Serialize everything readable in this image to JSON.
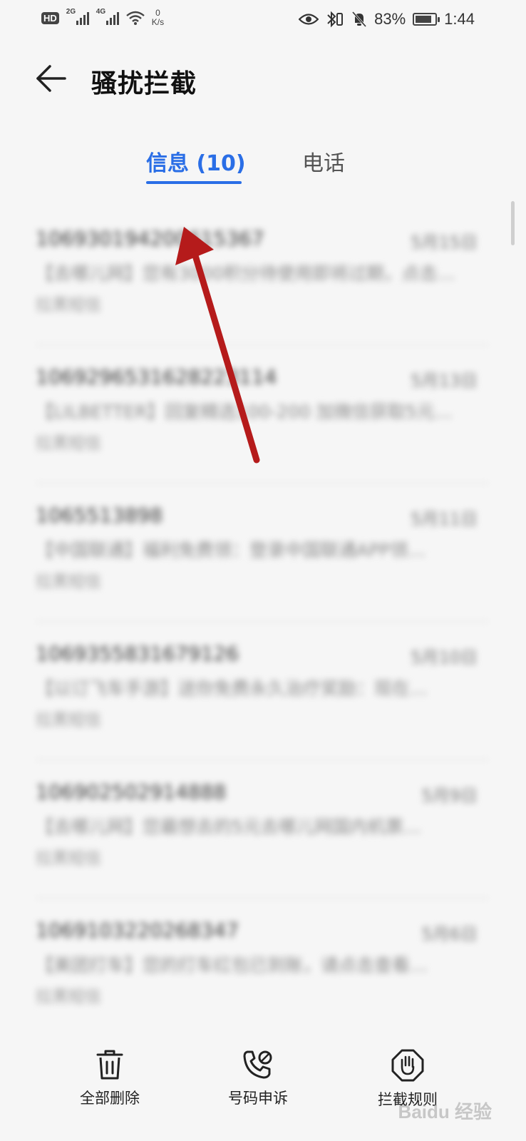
{
  "status_bar": {
    "hd_badge": "HD",
    "sim1_network": "2G",
    "sim2_network": "4G",
    "net_speed_value": "0",
    "net_speed_unit": "K/s",
    "battery_percent": "83%",
    "battery_level": 0.83,
    "time": "1:44"
  },
  "header": {
    "back_icon": "back-arrow-icon",
    "title": "骚扰拦截"
  },
  "tabs": [
    {
      "label": "信息 (10)",
      "selected": true
    },
    {
      "label": "电话",
      "selected": false
    }
  ],
  "messages": [
    {
      "number": "106930194200615367",
      "date": "5月15日",
      "preview": "【去哪儿网】您有3000积分待使用即将过期，点击…",
      "status": "拉黑短信"
    },
    {
      "number": "1069296531628223114",
      "date": "5月13日",
      "preview": "【LILBETTER】回复精选100-200 加微信获取5元…",
      "status": "拉黑短信"
    },
    {
      "number": "1065513898",
      "date": "5月11日",
      "preview": "【中国联通】福利免费领：登录中国联通APP领…",
      "status": "拉黑短信"
    },
    {
      "number": "1069355831679126",
      "date": "5月10日",
      "preview": "【以订飞车手游】送你免费永久治疗奖励：现在…",
      "status": "拉黑短信"
    },
    {
      "number": "106902502914888",
      "date": "5月9日",
      "preview": "【去哪儿网】您最想去的5元去哪儿网国内机票…",
      "status": "拉黑短信"
    },
    {
      "number": "1069103220268347",
      "date": "5月6日",
      "preview": "【美团打车】您的打车红包已到账，请点击查看…",
      "status": "拉黑短信"
    }
  ],
  "bottom_actions": [
    {
      "icon": "trash-icon",
      "label": "全部删除"
    },
    {
      "icon": "phone-appeal-icon",
      "label": "号码申诉"
    },
    {
      "icon": "hand-stop-icon",
      "label": "拦截规则"
    }
  ],
  "watermark": "Baidu 经验",
  "colors": {
    "accent": "#2a6ee6",
    "annotation_arrow": "#b51b1b",
    "background": "#f6f6f6"
  }
}
